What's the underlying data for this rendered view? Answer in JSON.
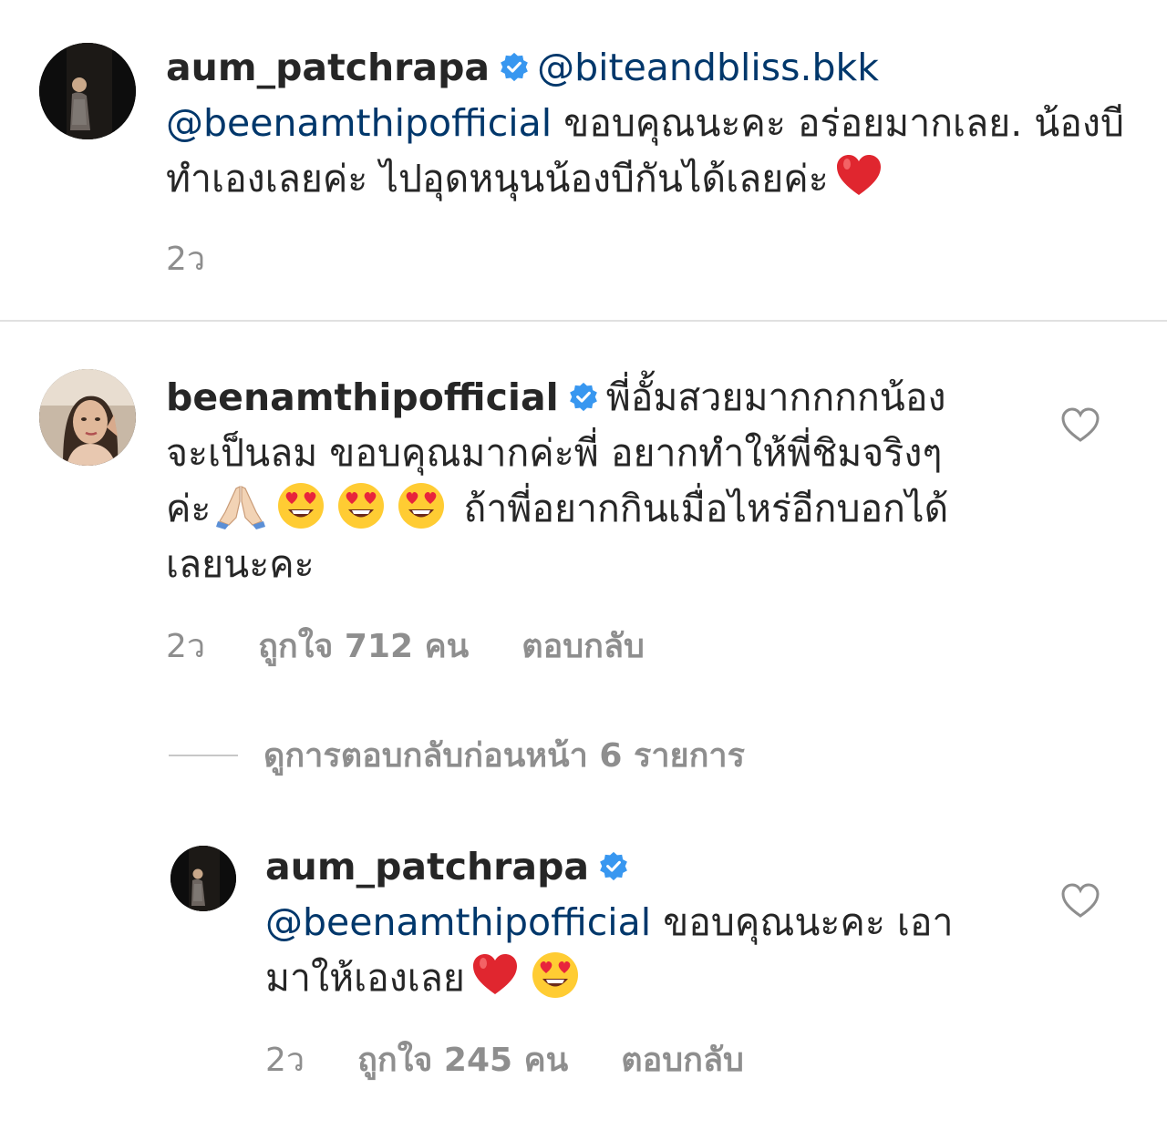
{
  "comments": [
    {
      "username": "aum_patchrapa",
      "mention_1": "@biteandbliss.bkk",
      "mention_2": "@beenamthipofficial",
      "text_1": " ขอบคุณนะคะ อร่อยมากเลย. น้องบีทำเองเลยค่ะ ไปอุดหนุนน้องบีกันได้เลยค่ะ",
      "time": "2ว"
    },
    {
      "username": "beenamthipofficial",
      "text_1": "พี่อั้มสวยมากกกกน้องจะเป็นลม ขอบคุณมากค่ะพี่ อยากทำให้พี่ชิมจริงๆค่ะ",
      "text_2": "ถ้าพี่อยากกินเมื่อไหร่อีกบอกได้เลยนะคะ",
      "time": "2ว",
      "likes": "ถูกใจ 712 คน",
      "reply": "ตอบกลับ"
    }
  ],
  "view_replies": "ดูการตอบกลับก่อนหน้า 6 รายการ",
  "reply": {
    "username": "aum_patchrapa",
    "mention": "@beenamthipofficial",
    "text": " ขอบคุณนะคะ เอามาให้เองเลย",
    "time": "2ว",
    "likes": "ถูกใจ 245 คน",
    "reply": "ตอบกลับ"
  },
  "icons": {
    "verified": "verified-badge-icon",
    "heart": "heart-outline-icon",
    "red_heart": "red-heart-emoji",
    "heart_eyes": "heart-eyes-emoji",
    "folded_hands": "folded-hands-emoji"
  },
  "colors": {
    "text": "#262626",
    "mention": "#00376b",
    "secondary": "#8e8e8e",
    "verified": "#3897f0",
    "red_heart": "#e0262f"
  }
}
